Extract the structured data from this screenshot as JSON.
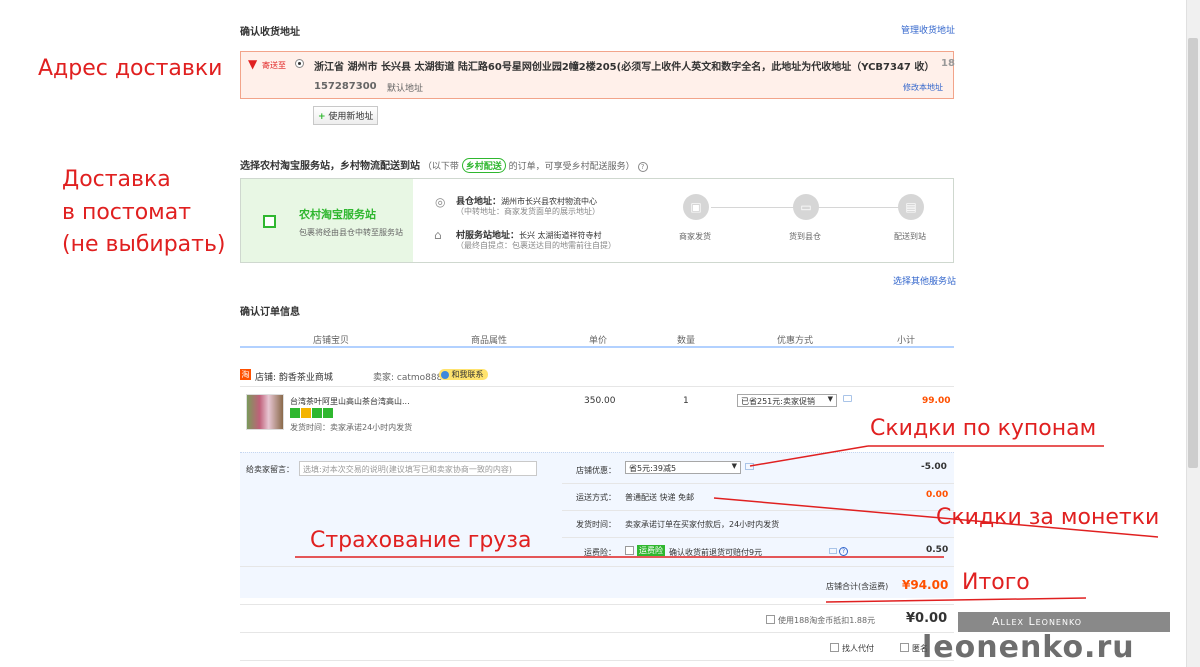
{
  "address_section": {
    "title": "确认收货地址",
    "manage_link": "管理收货地址",
    "send_to": "寄送至",
    "address_line": "浙江省 湖州市 长兴县 太湖街道 陆汇路60号星网创业园2幢2楼205(必须写上收件人英文和数字全名，此地址为代收地址（YCB7347 收）",
    "address_tail": "18",
    "phone": "157287300",
    "default_label": "默认地址",
    "edit_link": "修改本地址",
    "new_address_button": "使用新地址"
  },
  "rural_section": {
    "title": "选择农村淘宝服务站，乡村物流配送到站",
    "note_prefix": "（以下带",
    "badge": "乡村配送",
    "note_suffix": "的订单，可享受乡村配送服务）",
    "station_name": "农村淘宝服务站",
    "station_desc": "包裹将经由县仓中转至服务站",
    "county_label": "县仓地址：",
    "county_value": "湖州市长兴县农村物流中心",
    "county_sub": "（中转地址：商家发货面单的展示地址）",
    "village_label": "村服务站地址：",
    "village_value": "长兴 太湖街道祥符寺村",
    "village_sub": "（最终自提点：包裹送达目的地需前往自提）",
    "steps": [
      "商家发货",
      "货到县仓",
      "配送到站"
    ],
    "other_stations_link": "选择其他服务站"
  },
  "order_section": {
    "title": "确认订单信息",
    "columns": [
      "店铺宝贝",
      "商品属性",
      "单价",
      "数量",
      "优惠方式",
      "小计"
    ],
    "shop_label": "店铺: 韵香茶业商城",
    "seller_label": "卖家: catmo888",
    "contact_label": "和我联系",
    "item": {
      "title": "台湾茶叶阿里山高山茶台湾高山...",
      "delivery_time": "发货时间：卖家承诺24小时内发货",
      "price": "350.00",
      "quantity": "1",
      "discount_select": "已省251元:卖家促销",
      "subtotal": "99.00"
    },
    "message_label": "给卖家留言：",
    "message_placeholder": "选填:对本次交易的说明(建议填写已和卖家协商一致的内容)",
    "shop_discount_label": "店铺优惠：",
    "shop_discount_select": "省5元:39减5",
    "shop_discount_value": "-5.00",
    "shipping_label": "运送方式：",
    "shipping_value": "普通配送 快递 免邮",
    "shipping_price": "0.00",
    "ship_time_label": "发货时间：",
    "ship_time_value": "卖家承诺订单在买家付款后，24小时内发货",
    "insurance_label": "运费险：",
    "insurance_badge": "运费险",
    "insurance_text": "确认收货前退货可赔付9元",
    "insurance_price": "0.50",
    "total_label": "店铺合计(含运费)",
    "total_value": "¥94.00",
    "coins_text": "使用188淘金币抵扣1.88元",
    "coins_value": "¥0.00",
    "pay_for_me": "找人代付",
    "anonymous": "匿名"
  },
  "annotations": {
    "delivery_address": "Адрес доставки",
    "postomat_1": "Доставка",
    "postomat_2": "в постомат",
    "postomat_3": "(не выбирать)",
    "coupon_discounts": "Скидки по купонам",
    "coin_discounts": "Скидки за монетки",
    "cargo_insurance": "Страхование груза",
    "total": "Итого"
  },
  "watermark": {
    "author": "Allex Leonenko",
    "site": "leonenko.ru"
  },
  "colors": {
    "accent_red": "#e02020",
    "price_orange": "#ff5000",
    "link_blue": "#3366cc",
    "rural_green": "#2fb72f"
  }
}
